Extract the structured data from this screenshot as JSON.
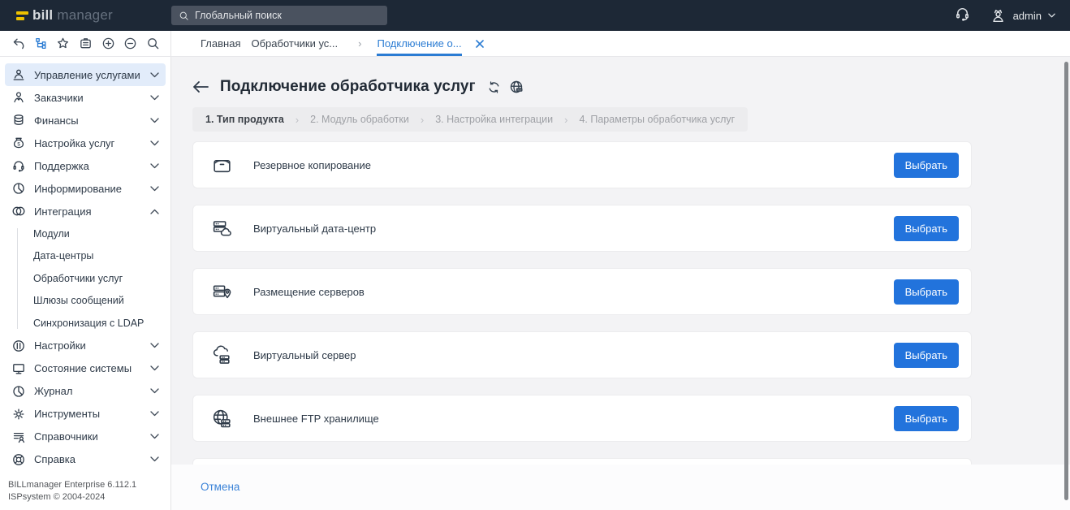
{
  "topbar": {
    "logo_primary": "bill",
    "logo_secondary": "manager",
    "search_placeholder": "Глобальный поиск",
    "username": "admin"
  },
  "toolbar": {
    "icons": [
      "back-icon",
      "hierarchy-icon",
      "star-icon",
      "tasks-icon",
      "zoom-in-icon",
      "zoom-out-icon",
      "search-icon"
    ]
  },
  "tabs": {
    "items": [
      {
        "label": "Главная",
        "active": false
      },
      {
        "label": "Обработчики ус...",
        "active": false
      },
      {
        "label": "Подключение о...",
        "active": true
      }
    ],
    "separator": "›"
  },
  "sidebar": {
    "items": [
      {
        "label": "Управление услугами",
        "state": "collapsed",
        "active": true
      },
      {
        "label": "Заказчики",
        "state": "collapsed"
      },
      {
        "label": "Финансы",
        "state": "collapsed"
      },
      {
        "label": "Настройка услуг",
        "state": "collapsed"
      },
      {
        "label": "Поддержка",
        "state": "collapsed"
      },
      {
        "label": "Информирование",
        "state": "collapsed"
      },
      {
        "label": "Интеграция",
        "state": "expanded"
      },
      {
        "label": "Настройки",
        "state": "collapsed"
      },
      {
        "label": "Состояние системы",
        "state": "collapsed"
      },
      {
        "label": "Журнал",
        "state": "collapsed"
      },
      {
        "label": "Инструменты",
        "state": "collapsed"
      },
      {
        "label": "Справочники",
        "state": "collapsed"
      },
      {
        "label": "Справка",
        "state": "collapsed"
      }
    ],
    "integration_children": [
      {
        "label": "Модули"
      },
      {
        "label": "Дата-центры"
      },
      {
        "label": "Обработчики услуг"
      },
      {
        "label": "Шлюзы сообщений"
      },
      {
        "label": "Синхронизация с LDAP"
      }
    ],
    "footer": {
      "line1": "BILLmanager Enterprise 6.112.1",
      "line2": "ISPsystem © 2004-2024"
    }
  },
  "main": {
    "title": "Подключение обработчика услуг",
    "steps": [
      "1. Тип продукта",
      "2. Модуль обработки",
      "3. Настройка интеграции",
      "4. Параметры обработчика услуг"
    ],
    "active_step_index": 0,
    "step_separator": "›",
    "products": [
      {
        "label": "Резервное копирование",
        "icon": "backup-icon",
        "button": "Выбрать"
      },
      {
        "label": "Виртуальный дата-центр",
        "icon": "datacenter-icon",
        "button": "Выбрать"
      },
      {
        "label": "Размещение серверов",
        "icon": "colocation-icon",
        "button": "Выбрать"
      },
      {
        "label": "Виртуальный сервер",
        "icon": "virtual-server-icon",
        "button": "Выбрать"
      },
      {
        "label": "Внешнее FTP хранилище",
        "icon": "ftp-storage-icon",
        "button": "Выбрать"
      }
    ],
    "cancel": "Отмена"
  },
  "colors": {
    "topbar_bg": "#1d2836",
    "logo_yellow": "#eec200",
    "accent_blue": "#2b7cd3",
    "button_blue": "#2273dc",
    "main_bg": "#f3f3f5"
  }
}
